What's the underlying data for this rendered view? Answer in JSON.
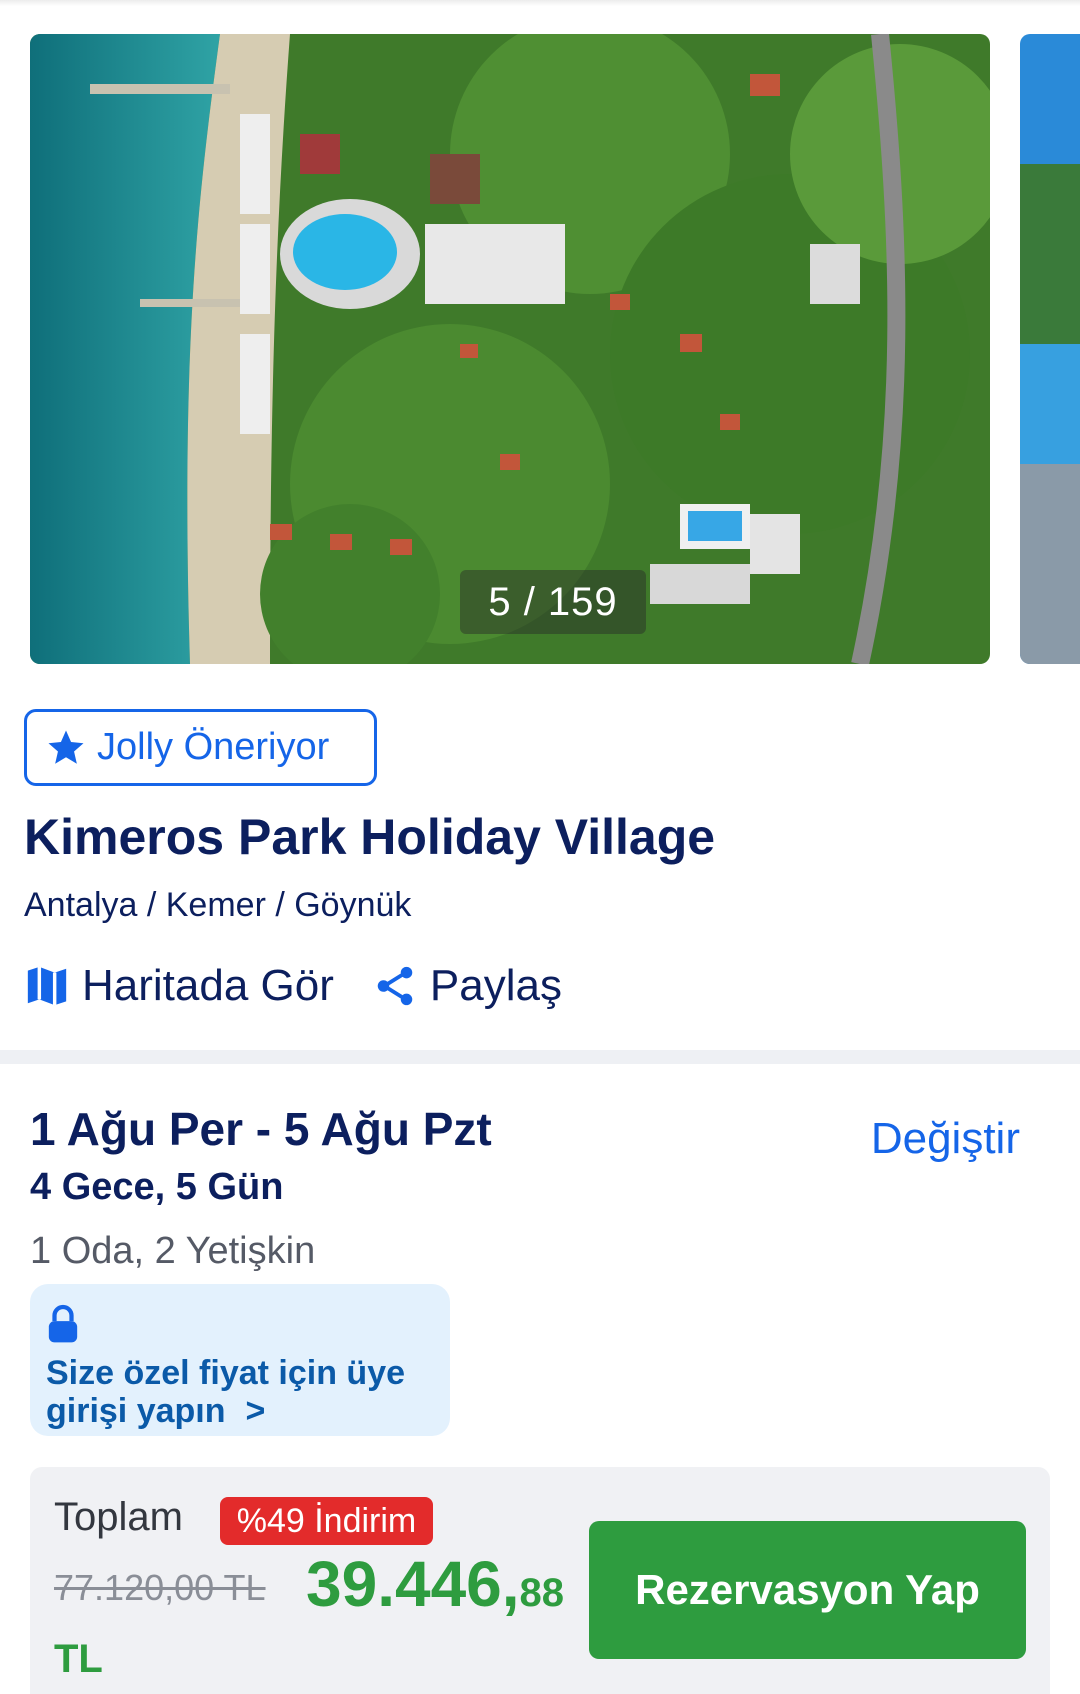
{
  "gallery": {
    "counter": "5 / 159"
  },
  "badge": {
    "icon": "star-icon",
    "label": "Jolly Öneriyor"
  },
  "hotel": {
    "name": "Kimeros Park Holiday Village",
    "location": "Antalya / Kemer / Göynük"
  },
  "actions": {
    "map": {
      "icon": "map-icon",
      "label": "Haritada Gör"
    },
    "share": {
      "icon": "share-icon",
      "label": "Paylaş"
    }
  },
  "booking": {
    "dates": "1 Ağu Per - 5 Ağu Pzt",
    "nights": "4 Gece, 5 Gün",
    "guests": "1 Oda, 2 Yetişkin",
    "change_label": "Değiştir"
  },
  "login_prompt": {
    "icon": "lock-icon",
    "text": "Size özel fiyat için üye girişi yapın",
    "chevron": ">"
  },
  "price": {
    "total_label": "Toplam",
    "discount_badge": "%49 İndirim",
    "old_price": "77.120,00 TL",
    "new_price_main": "39.446,",
    "new_price_decimals": "88",
    "currency": "TL",
    "reserve_button": "Rezervasyon Yap"
  },
  "colors": {
    "brand_blue": "#1565e8",
    "navy_text": "#0c1f5e",
    "price_green": "#2e9c3f",
    "discount_red": "#e32b2b"
  }
}
